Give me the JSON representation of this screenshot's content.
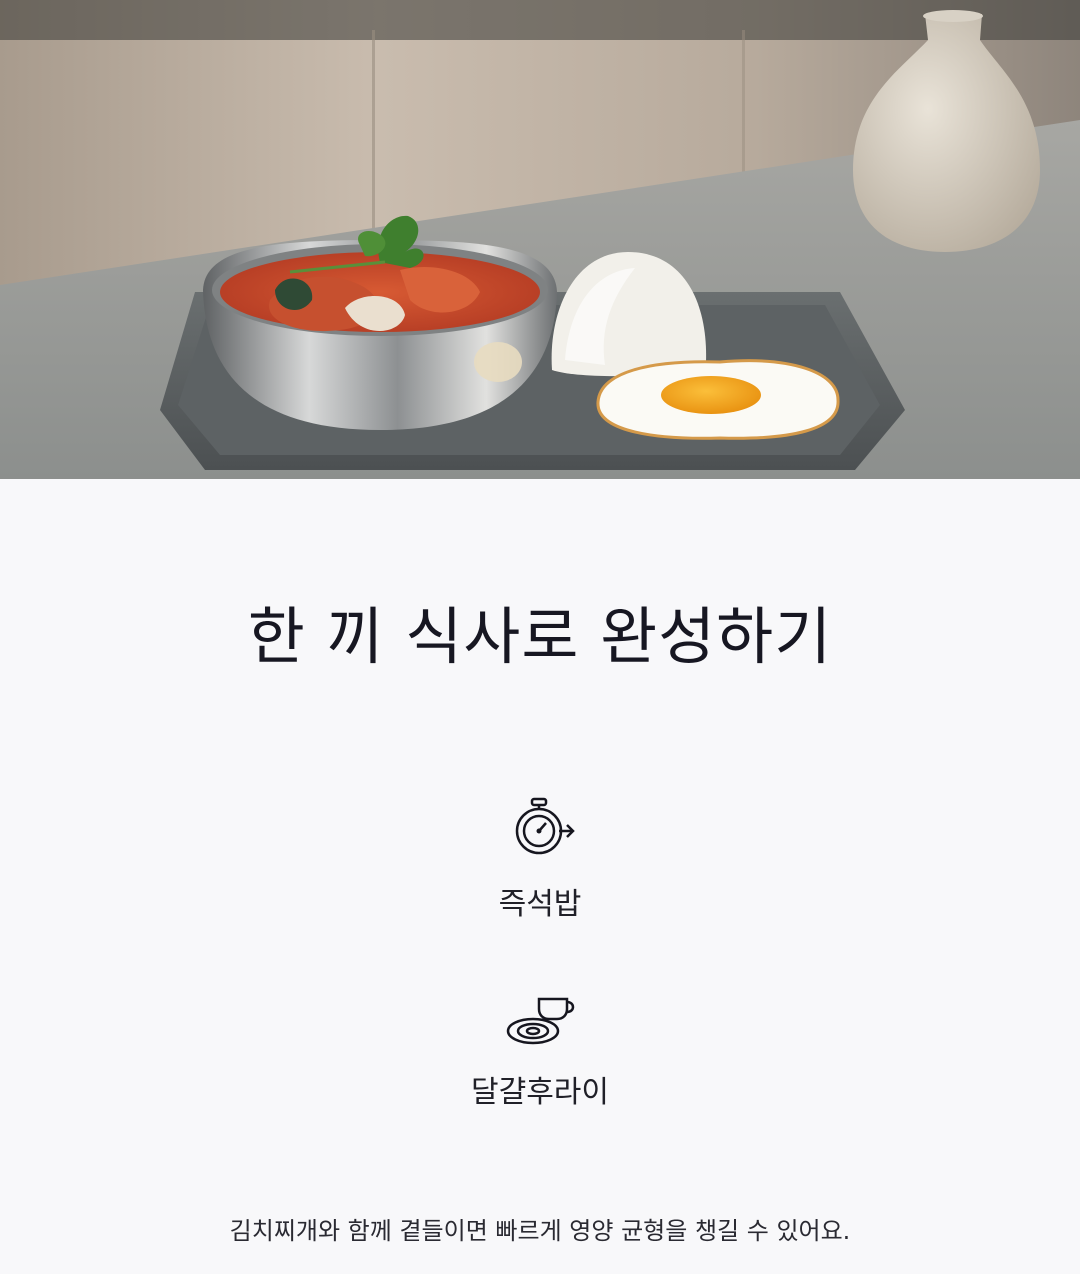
{
  "hero": {
    "image_description": "",
    "icon": "food-photo-image"
  },
  "main": {
    "title": "한 끼 식사로 완성하기",
    "features": [
      {
        "icon": "stopwatch-arrow-icon",
        "label": "즉석밥"
      },
      {
        "icon": "fried-egg-cup-icon",
        "label": "달걀후라이"
      }
    ],
    "description": "김치찌개와 함께 곁들이면 빠르게 영양 균형을 챙길 수 있어요."
  },
  "colors": {
    "background": "#f8f8fa",
    "text": "#171722",
    "egg_yolk": "#f2a51e",
    "stew": "#c9432a"
  }
}
